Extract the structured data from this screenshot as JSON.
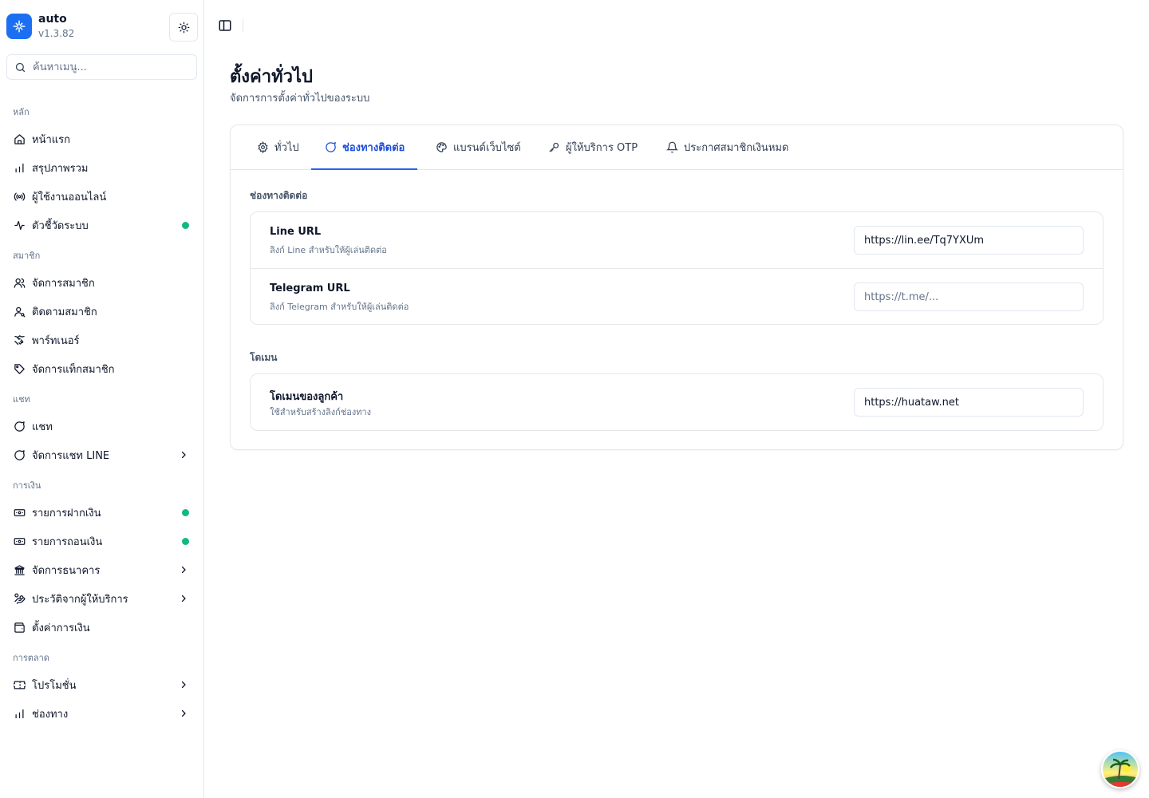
{
  "app": {
    "name": "auto",
    "version": "v1.3.82"
  },
  "search": {
    "placeholder": "ค้นหาเมนู..."
  },
  "sidebar": {
    "groups": [
      {
        "label": "หลัก",
        "items": [
          {
            "label": "หน้าแรก",
            "icon": "home-icon"
          },
          {
            "label": "สรุปภาพรวม",
            "icon": "bar-chart-icon"
          },
          {
            "label": "ผู้ใช้งานออนไลน์",
            "icon": "radio-icon"
          },
          {
            "label": "ตัวชี้วัดระบบ",
            "icon": "activity-icon",
            "status_dot": true
          }
        ]
      },
      {
        "label": "สมาชิก",
        "items": [
          {
            "label": "จัดการสมาชิก",
            "icon": "users-icon"
          },
          {
            "label": "ติดตามสมาชิก",
            "icon": "user-search-icon"
          },
          {
            "label": "พาร์ทเนอร์",
            "icon": "handshake-icon"
          },
          {
            "label": "จัดการแท็กสมาชิก",
            "icon": "tag-icon"
          }
        ]
      },
      {
        "label": "แชท",
        "items": [
          {
            "label": "แชท",
            "icon": "message-circle-icon"
          },
          {
            "label": "จัดการแชท LINE",
            "icon": "message-circle-icon",
            "chevron": true
          }
        ]
      },
      {
        "label": "การเงิน",
        "items": [
          {
            "label": "รายการฝากเงิน",
            "icon": "banknote-in-icon",
            "status_dot": true
          },
          {
            "label": "รายการถอนเงิน",
            "icon": "banknote-out-icon",
            "status_dot": true
          },
          {
            "label": "จัดการธนาคาร",
            "icon": "landmark-icon",
            "chevron": true
          },
          {
            "label": "ประวัติจากผู้ให้บริการ",
            "icon": "hand-coins-icon",
            "chevron": true
          },
          {
            "label": "ตั้งค่าการเงิน",
            "icon": "wallet-icon"
          }
        ]
      },
      {
        "label": "การตลาด",
        "items": [
          {
            "label": "โปรโมชั่น",
            "icon": "ticket-icon",
            "chevron": true
          },
          {
            "label": "ช่องทาง",
            "icon": "bar-chart-icon",
            "chevron": true
          }
        ]
      }
    ]
  },
  "page": {
    "title": "ตั้งค่าทั่วไป",
    "subtitle": "จัดการการตั้งค่าทั่วไปของระบบ"
  },
  "tabs": [
    {
      "label": "ทั่วไป",
      "icon": "gear-icon",
      "active": false
    },
    {
      "label": "ช่องทางติดต่อ",
      "icon": "message-circle-icon",
      "active": true
    },
    {
      "label": "แบรนด์เว็บไซต์",
      "icon": "palette-icon",
      "active": false
    },
    {
      "label": "ผู้ให้บริการ OTP",
      "icon": "key-icon",
      "active": false
    },
    {
      "label": "ประกาศสมาชิกเงินหมด",
      "icon": "bell-icon",
      "active": false
    }
  ],
  "sections": [
    {
      "label": "ช่องทางติดต่อ",
      "rows": [
        {
          "title": "Line URL",
          "description": "ลิงก์ Line สำหรับให้ผู้เล่นติดต่อ",
          "value": "https://lin.ee/Tq7YXUm",
          "placeholder": ""
        },
        {
          "title": "Telegram URL",
          "description": "ลิงก์ Telegram สำหรับให้ผู้เล่นติดต่อ",
          "value": "",
          "placeholder": "https://t.me/..."
        }
      ]
    },
    {
      "label": "โดเมน",
      "rows": [
        {
          "title": "โดเมนของลูกค้า",
          "description": "ใช้สำหรับสร้างลิงก์ช่องทาง",
          "value": "https://huataw.net",
          "placeholder": ""
        }
      ]
    }
  ],
  "colors": {
    "accent": "#2563eb",
    "logo_bg": "#1d6ff2",
    "status_dot": "#10b981"
  }
}
